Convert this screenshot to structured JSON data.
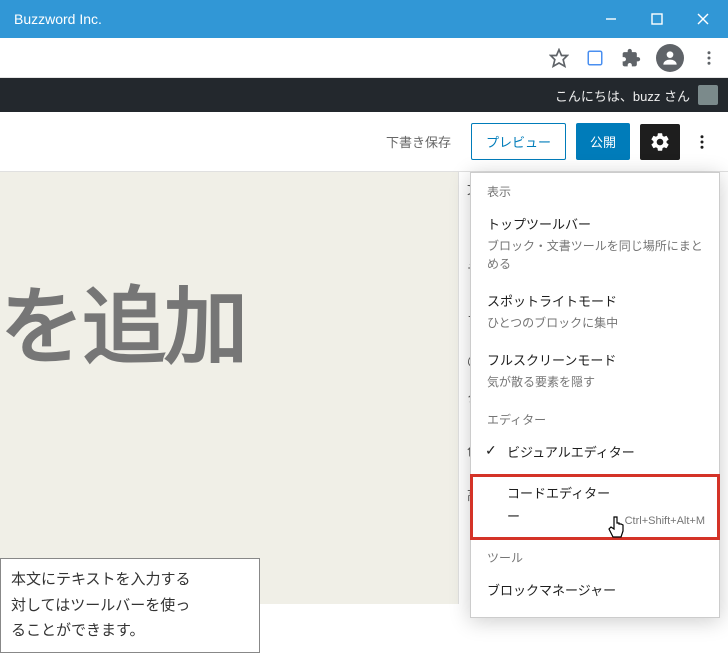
{
  "window": {
    "title": "Buzzword Inc."
  },
  "wpbar": {
    "greeting": "こんにちは、buzz さん"
  },
  "header": {
    "draft": "下書き保存",
    "preview": "プレビュー",
    "publish": "公開"
  },
  "content": {
    "title_placeholder": "を追加",
    "paragraph": "本文にテキストを入力する\n対してはツールバーを使っ\nることができます。"
  },
  "sidebar_hidden": [
    "文",
    "テ",
    "ブ",
    "@",
    "タ",
    "色",
    "高"
  ],
  "dropdown": {
    "section_view": "表示",
    "items_view": [
      {
        "title": "トップツールバー",
        "desc": "ブロック・文書ツールを同じ場所にまとめる"
      },
      {
        "title": "スポットライトモード",
        "desc": "ひとつのブロックに集中"
      },
      {
        "title": "フルスクリーンモード",
        "desc": "気が散る要素を隠す"
      }
    ],
    "section_editor": "エディター",
    "items_editor": [
      {
        "title": "ビジュアルエディター",
        "checked": true
      },
      {
        "title": "コードエディター",
        "shortcut": "Ctrl+Shift+Alt+M",
        "highlighted": true
      }
    ],
    "section_tools": "ツール",
    "items_tools": [
      {
        "title": "ブロックマネージャー"
      }
    ]
  }
}
